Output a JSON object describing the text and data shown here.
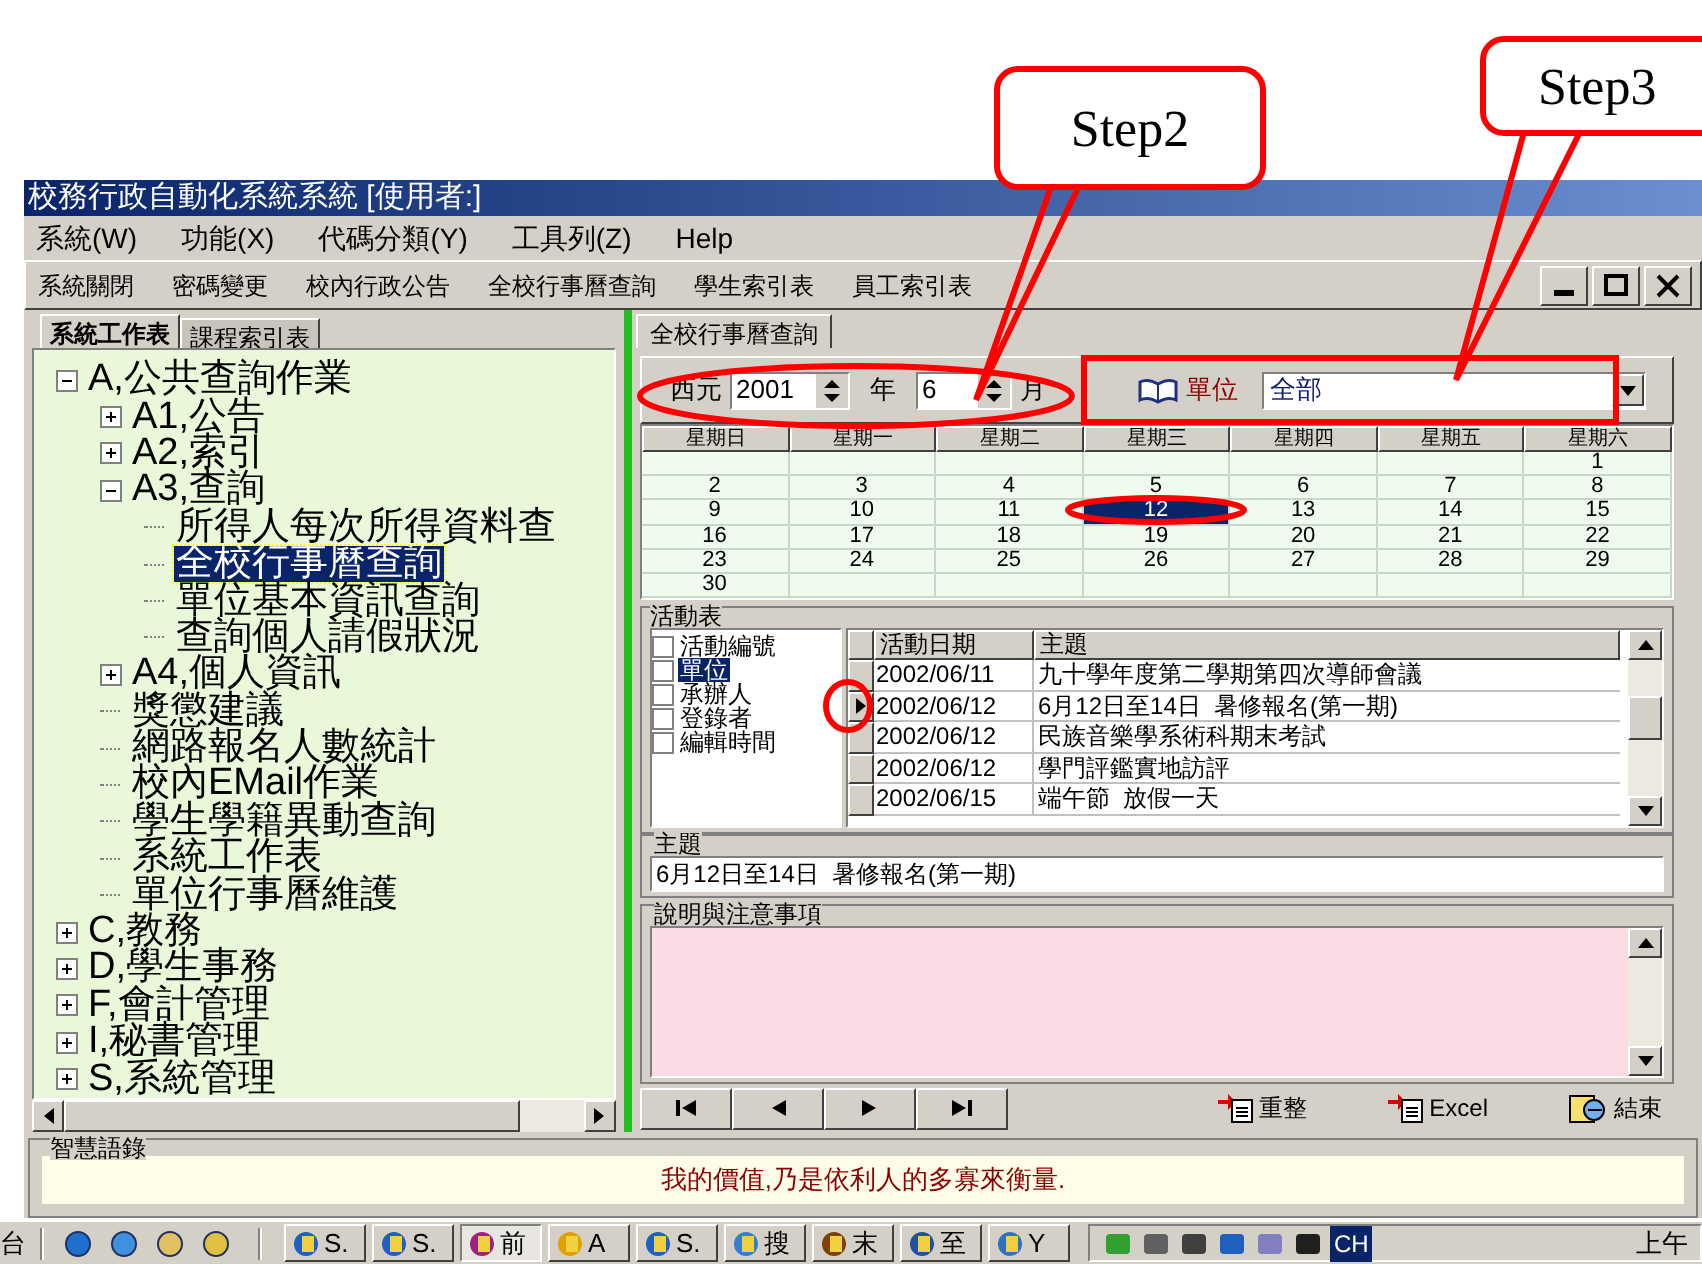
{
  "callouts": [
    {
      "label": "Step2"
    },
    {
      "label": "Step3"
    }
  ],
  "window": {
    "title": "校務行政自動化系統系統 [使用者:]"
  },
  "menu": [
    "系統(W)",
    "功能(X)",
    "代碼分類(Y)",
    "工具列(Z)",
    "Help"
  ],
  "toolbar": [
    "系統關閉",
    "密碼變更",
    "校內行政公告",
    "全校行事曆查詢",
    "學生索引表",
    "員工索引表"
  ],
  "left_tabs": [
    {
      "label": "系統工作表",
      "selected": true
    },
    {
      "label": "課程索引表",
      "selected": false
    }
  ],
  "tree": [
    {
      "label": "A,公共查詢作業",
      "kind": "folder",
      "expanded": true,
      "selected": false,
      "children": [
        {
          "label": "A1,公告",
          "kind": "folder",
          "expanded": false,
          "selected": false
        },
        {
          "label": "A2,索引",
          "kind": "folder",
          "expanded": false,
          "selected": false
        },
        {
          "label": "A3,查詢",
          "kind": "folder",
          "expanded": true,
          "selected": false,
          "children": [
            {
              "label": "所得人每次所得資料查",
              "kind": "leaf",
              "selected": false
            },
            {
              "label": "全校行事曆查詢",
              "kind": "leaf",
              "selected": true
            },
            {
              "label": "單位基本資訊查詢",
              "kind": "leaf",
              "selected": false
            },
            {
              "label": "查詢個人請假狀況",
              "kind": "leaf",
              "selected": false
            }
          ]
        },
        {
          "label": "A4,個人資訊",
          "kind": "folder",
          "expanded": false,
          "selected": false
        },
        {
          "label": "獎懲建議",
          "kind": "leaf",
          "selected": false
        },
        {
          "label": "網路報名人數統計",
          "kind": "leaf",
          "selected": false
        },
        {
          "label": "校內EMail作業",
          "kind": "leaf",
          "selected": false
        },
        {
          "label": "學生學籍異動查詢",
          "kind": "leaf",
          "selected": false
        },
        {
          "label": "系統工作表",
          "kind": "leaf",
          "selected": false
        },
        {
          "label": "單位行事曆維護",
          "kind": "leaf",
          "selected": false
        }
      ]
    },
    {
      "label": "C,教務",
      "kind": "folder",
      "expanded": false,
      "selected": false
    },
    {
      "label": "D,學生事務",
      "kind": "folder",
      "expanded": false,
      "selected": false
    },
    {
      "label": "F,會計管理",
      "kind": "folder",
      "expanded": false,
      "selected": false
    },
    {
      "label": "I,秘書管理",
      "kind": "folder",
      "expanded": false,
      "selected": false
    },
    {
      "label": "S,系統管理",
      "kind": "folder",
      "expanded": false,
      "selected": false
    }
  ],
  "right_tab": {
    "label": "全校行事曆查詢",
    "selected": true
  },
  "filter": {
    "era_label": "西元",
    "year": "2001",
    "year_unit": "年",
    "month": "6",
    "month_unit": "月",
    "unit_label": "單位",
    "unit_value": "全部"
  },
  "calendar": {
    "headers": [
      "星期日",
      "星期一",
      "星期二",
      "星期三",
      "星期四",
      "星期五",
      "星期六"
    ],
    "weeks": [
      [
        {
          "kind": "blank"
        },
        {
          "kind": "blank"
        },
        {
          "kind": "blank"
        },
        {
          "kind": "blank"
        },
        {
          "kind": "blank"
        },
        {
          "kind": "blank"
        },
        {
          "kind": "day",
          "day": "1",
          "selected": false
        }
      ],
      [
        {
          "kind": "day",
          "day": "2",
          "selected": false
        },
        {
          "kind": "day",
          "day": "3",
          "selected": false
        },
        {
          "kind": "day",
          "day": "4",
          "selected": false
        },
        {
          "kind": "day",
          "day": "5",
          "selected": false
        },
        {
          "kind": "day",
          "day": "6",
          "selected": false
        },
        {
          "kind": "day",
          "day": "7",
          "selected": false
        },
        {
          "kind": "day",
          "day": "8",
          "selected": false
        }
      ],
      [
        {
          "kind": "day",
          "day": "9",
          "selected": false
        },
        {
          "kind": "day",
          "day": "10",
          "selected": false
        },
        {
          "kind": "day",
          "day": "11",
          "selected": false
        },
        {
          "kind": "day",
          "day": "12",
          "selected": true
        },
        {
          "kind": "day",
          "day": "13",
          "selected": false
        },
        {
          "kind": "day",
          "day": "14",
          "selected": false
        },
        {
          "kind": "day",
          "day": "15",
          "selected": false
        }
      ],
      [
        {
          "kind": "day",
          "day": "16",
          "selected": false
        },
        {
          "kind": "day",
          "day": "17",
          "selected": false
        },
        {
          "kind": "day",
          "day": "18",
          "selected": false
        },
        {
          "kind": "day",
          "day": "19",
          "selected": false
        },
        {
          "kind": "day",
          "day": "20",
          "selected": false
        },
        {
          "kind": "day",
          "day": "21",
          "selected": false
        },
        {
          "kind": "day",
          "day": "22",
          "selected": false
        }
      ],
      [
        {
          "kind": "day",
          "day": "23",
          "selected": false
        },
        {
          "kind": "day",
          "day": "24",
          "selected": false
        },
        {
          "kind": "day",
          "day": "25",
          "selected": false
        },
        {
          "kind": "day",
          "day": "26",
          "selected": false
        },
        {
          "kind": "day",
          "day": "27",
          "selected": false
        },
        {
          "kind": "day",
          "day": "28",
          "selected": false
        },
        {
          "kind": "day",
          "day": "29",
          "selected": false
        }
      ],
      [
        {
          "kind": "day",
          "day": "30",
          "selected": false
        },
        {
          "kind": "blank"
        },
        {
          "kind": "blank"
        },
        {
          "kind": "blank"
        },
        {
          "kind": "blank"
        },
        {
          "kind": "blank"
        },
        {
          "kind": "blank"
        }
      ]
    ]
  },
  "activity": {
    "title": "活動表",
    "fields": [
      {
        "label": "活動編號",
        "checked": false,
        "selected": false
      },
      {
        "label": "單位",
        "checked": false,
        "selected": true
      },
      {
        "label": "承辦人",
        "checked": false,
        "selected": false
      },
      {
        "label": "登錄者",
        "checked": false,
        "selected": false
      },
      {
        "label": "編輯時間",
        "checked": false,
        "selected": false
      }
    ],
    "columns": [
      "活動日期",
      "主題"
    ],
    "rows": [
      {
        "date": "2002/06/11",
        "title": "九十學年度第二學期第四次導師會議",
        "selected": false
      },
      {
        "date": "2002/06/12",
        "title": "6月12日至14日  暑修報名(第一期)",
        "selected": true
      },
      {
        "date": "2002/06/12",
        "title": "民族音樂學系術科期末考試",
        "selected": false
      },
      {
        "date": "2002/06/12",
        "title": "學門評鑑實地訪評",
        "selected": false
      },
      {
        "date": "2002/06/15",
        "title": "端午節  放假一天",
        "selected": false
      }
    ]
  },
  "subject": {
    "label": "主題",
    "value": "6月12日至14日  暑修報名(第一期)"
  },
  "notes": {
    "label": "說明與注意事項"
  },
  "actions": [
    {
      "label": "重整",
      "kind": "refresh"
    },
    {
      "label": "Excel",
      "kind": "excel"
    },
    {
      "label": "結束",
      "kind": "exit"
    }
  ],
  "quote": {
    "title": "智慧語錄",
    "text": "我的價值,乃是依利人的多寡來衡量."
  },
  "taskbar": {
    "left_text": "台",
    "tasks": [
      {
        "label": "S.",
        "selected": false
      },
      {
        "label": "S.",
        "selected": false
      },
      {
        "label": "前",
        "selected": true
      },
      {
        "label": "A",
        "selected": false
      },
      {
        "label": "S.",
        "selected": false
      },
      {
        "label": "搜",
        "selected": false
      },
      {
        "label": "末",
        "selected": false
      },
      {
        "label": "至",
        "selected": false
      },
      {
        "label": "Y",
        "selected": false
      }
    ],
    "language": "CH",
    "clock": "上午"
  }
}
